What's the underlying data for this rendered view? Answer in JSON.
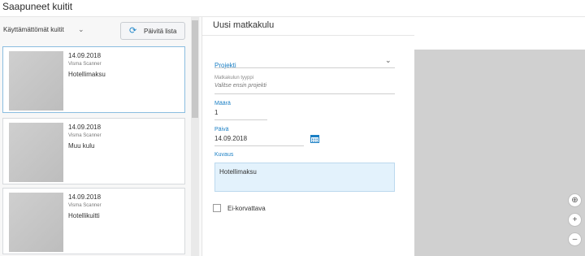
{
  "header": {
    "title": "Saapuneet kuitit"
  },
  "receipts_panel": {
    "filter": {
      "selected": "Käyttämättömät kuitit",
      "chevron_icon": "chevron-down-icon"
    },
    "refresh_button": {
      "label": "Päivitä lista",
      "icon": "refresh-icon"
    },
    "receipts": [
      {
        "date": "14.09.2018",
        "source": "Visma Scanner",
        "name": "Hotellimaksu",
        "selected": true
      },
      {
        "date": "14.09.2018",
        "source": "Visma Scanner",
        "name": "Muu kulu",
        "selected": false
      },
      {
        "date": "14.09.2018",
        "source": "Visma Scanner",
        "name": "Hotellikuitti",
        "selected": false
      }
    ]
  },
  "form": {
    "title": "Uusi matkakulu",
    "project": {
      "label": "Projekti"
    },
    "expense_type": {
      "label": "Matkakulun tyyppi",
      "hint": "Valitse ensin projekti"
    },
    "amount": {
      "label": "Määrä",
      "value": "1"
    },
    "date": {
      "label": "Päivä",
      "value": "14.09.2018",
      "icon": "calendar-icon"
    },
    "description": {
      "label": "Kuvaus",
      "value": "Hotellimaksu"
    },
    "non_reimbursable": {
      "label": "Ei-korvattava",
      "checked": false
    }
  },
  "preview": {
    "controls": [
      {
        "icon": "fit-screen-icon",
        "glyph": "⊕"
      },
      {
        "icon": "zoom-in-icon",
        "glyph": "+"
      },
      {
        "icon": "zoom-out-icon",
        "glyph": "–"
      }
    ]
  },
  "colors": {
    "accent": "#1b7fc4",
    "selected_border": "#8bbde0",
    "textarea_bg": "#e3f2fc"
  }
}
